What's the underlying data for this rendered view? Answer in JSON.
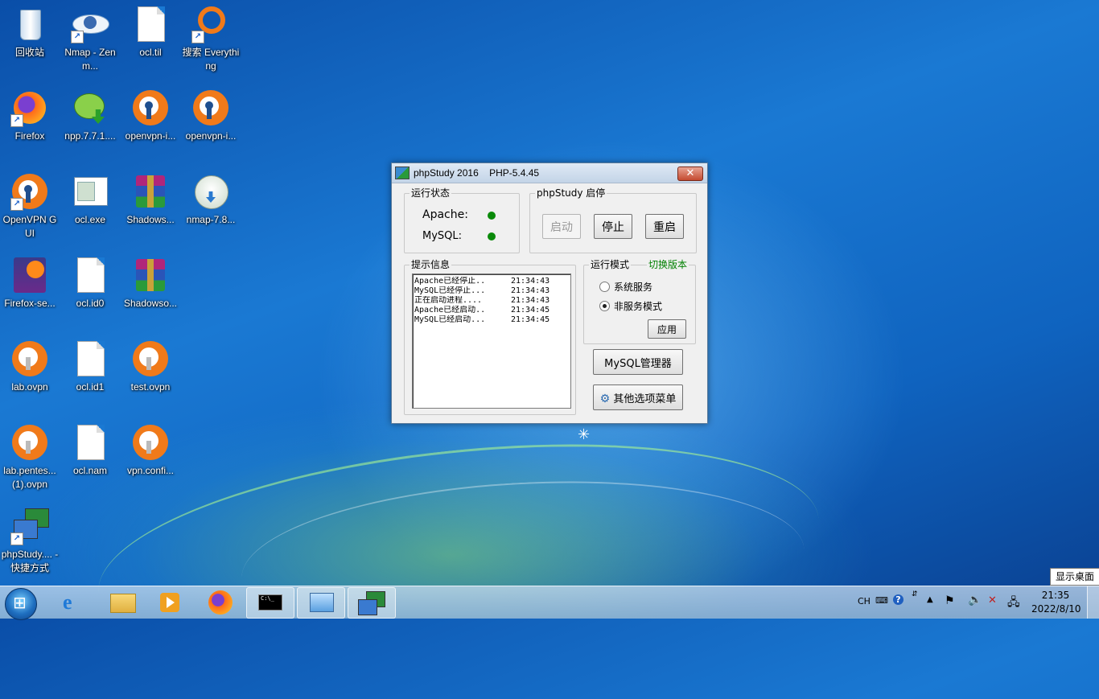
{
  "desktop_icons": [
    {
      "label": "回收站",
      "icon": "recycle-bin-icon"
    },
    {
      "label": "Nmap - Zenm...",
      "icon": "nmap-zenmap-icon"
    },
    {
      "label": "ocl.til",
      "icon": "file-icon"
    },
    {
      "label": "搜索 Everything",
      "icon": "everything-search-icon"
    },
    {
      "label": "Firefox",
      "icon": "firefox-icon"
    },
    {
      "label": "npp.7.7.1....",
      "icon": "notepad-plus-plus-installer-icon"
    },
    {
      "label": "openvpn-i...",
      "icon": "openvpn-installer-icon"
    },
    {
      "label": "openvpn-i...",
      "icon": "openvpn-installer-icon"
    },
    {
      "label": "OpenVPN GUI",
      "icon": "openvpn-gui-icon"
    },
    {
      "label": "ocl.exe",
      "icon": "exe-window-icon"
    },
    {
      "label": "Shadows...",
      "icon": "winrar-archive-icon"
    },
    {
      "label": "nmap-7.8...",
      "icon": "nsis-installer-icon"
    },
    {
      "label": "Firefox-se...",
      "icon": "firefox-setup-archive-icon"
    },
    {
      "label": "ocl.id0",
      "icon": "file-icon"
    },
    {
      "label": "Shadowso...",
      "icon": "winrar-archive-icon"
    },
    {
      "label": "lab.ovpn",
      "icon": "openvpn-config-icon"
    },
    {
      "label": "ocl.id1",
      "icon": "file-icon"
    },
    {
      "label": "test.ovpn",
      "icon": "openvpn-config-icon"
    },
    {
      "label": "lab.pentes... (1).ovpn",
      "icon": "openvpn-config-icon"
    },
    {
      "label": "ocl.nam",
      "icon": "file-icon"
    },
    {
      "label": "vpn.confi...",
      "icon": "openvpn-config-icon"
    },
    {
      "label": "phpStudy.... - 快捷方式",
      "icon": "phpstudy-shortcut-icon"
    }
  ],
  "window": {
    "title": "phpStudy 2016    PHP-5.4.45",
    "close_label": "✕",
    "status_group": {
      "legend": "运行状态",
      "apache_label": "Apache:",
      "mysql_label": "MySQL:",
      "apache_color": "#0a8a0a",
      "mysql_color": "#0a8a0a"
    },
    "control_group": {
      "legend": "phpStudy 启停",
      "start_label": "启动",
      "stop_label": "停止",
      "restart_label": "重启"
    },
    "info_group": {
      "legend": "提示信息",
      "log": [
        {
          "msg": "Apache已经停止..",
          "time": "21:34:43"
        },
        {
          "msg": "MySQL已经停止...",
          "time": "21:34:43"
        },
        {
          "msg": "正在启动进程....",
          "time": "21:34:43"
        },
        {
          "msg": "Apache已经启动..",
          "time": "21:34:45"
        },
        {
          "msg": "MySQL已经启动...",
          "time": "21:34:45"
        }
      ]
    },
    "mode_group": {
      "legend": "运行模式",
      "switch_label": "切换版本",
      "switch_color": "#008000",
      "option_service": "系统服务",
      "option_nonservice": "非服务模式",
      "selected": "非服务模式",
      "apply_label": "应用"
    },
    "mysql_manager_label": "MySQL管理器",
    "other_menu_label": "其他选项菜单"
  },
  "taskbar": {
    "pinned": [
      "internet-explorer-icon",
      "file-explorer-icon",
      "media-player-icon",
      "firefox-icon",
      "cmd-icon",
      "remote-desktop-icon",
      "phpstudy-icon"
    ],
    "tray": {
      "ime": "CH",
      "time": "21:35",
      "date": "2022/8/10"
    },
    "show_desktop_tooltip": "显示桌面"
  }
}
